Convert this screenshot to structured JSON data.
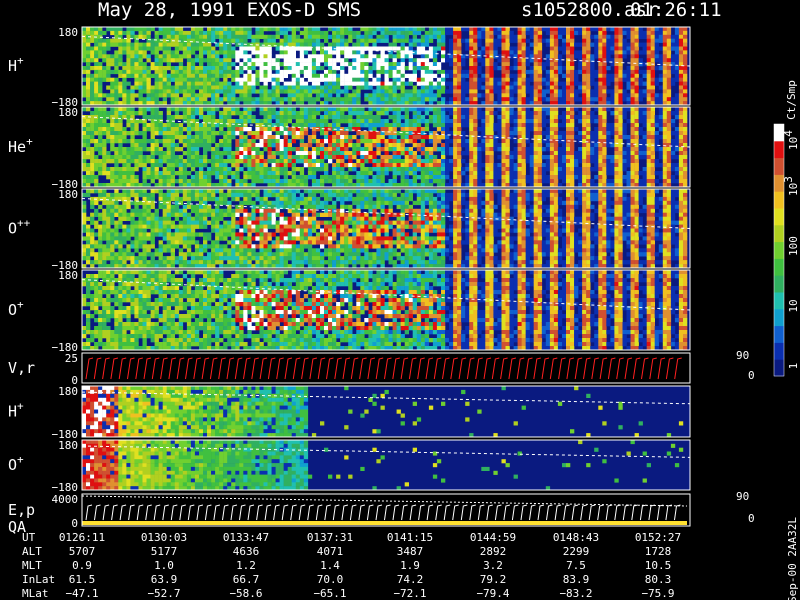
{
  "header": {
    "title": "May 28, 1991   EXOS-D SMS",
    "file": "s1052800.asr",
    "time": "01:26:11"
  },
  "colorbar": {
    "label": "Ct/Smp",
    "ticks": [
      "10",
      "10",
      "100",
      "10",
      "1"
    ],
    "exponents": [
      "4",
      "3",
      "",
      "",
      ""
    ],
    "levels": [
      10000,
      1000,
      100,
      10,
      1
    ]
  },
  "side_label": "Sep-00  2AA32L",
  "panels": [
    {
      "name": "H",
      "sup": "+",
      "ymax": "180",
      "ymin": "−180",
      "type": "spectrogram",
      "intensity": 0.9,
      "onset": 0.0
    },
    {
      "name": "He",
      "sup": "+",
      "ymax": "180",
      "ymin": "−180",
      "type": "spectrogram",
      "intensity": 0.55,
      "onset": 0.0
    },
    {
      "name": "O",
      "sup": "++",
      "ymax": "180",
      "ymin": "−180",
      "type": "spectrogram",
      "intensity": 0.55,
      "onset": 0.0
    },
    {
      "name": "O",
      "sup": "+",
      "ymax": "180",
      "ymin": "−180",
      "type": "spectrogram",
      "intensity": 0.6,
      "onset": 0.0
    },
    {
      "name": "V,r",
      "sup": "",
      "ymax": "25",
      "ymin": "0",
      "right_max": "90",
      "right_min": "0",
      "type": "line"
    },
    {
      "name": "H",
      "sup": "+",
      "ymax": "180",
      "ymin": "−180",
      "type": "spectrogram2",
      "intensity": 0.8,
      "onset": 0.0
    },
    {
      "name": "O",
      "sup": "+",
      "ymax": "180",
      "ymin": "−180",
      "type": "spectrogram2",
      "intensity": 0.55,
      "onset": 0.0
    },
    {
      "name": "E,p",
      "sup": "",
      "name2": "QA",
      "ymax": "4000",
      "ymin": "0",
      "right_max": "90",
      "right_min": "0",
      "type": "energy"
    }
  ],
  "footer": {
    "rows": [
      {
        "label": "UT",
        "values": [
          "0126:11",
          "0130:03",
          "0133:47",
          "0137:31",
          "0141:15",
          "0144:59",
          "0148:43",
          "0152:27"
        ]
      },
      {
        "label": "ALT",
        "values": [
          "5707",
          "5177",
          "4636",
          "4071",
          "3487",
          "2892",
          "2299",
          "1728"
        ]
      },
      {
        "label": "MLT",
        "values": [
          "0.9",
          "1.0",
          "1.2",
          "1.4",
          "1.9",
          "3.2",
          "7.5",
          "10.5"
        ]
      },
      {
        "label": "InLat",
        "values": [
          "61.5",
          "63.9",
          "66.7",
          "70.0",
          "74.2",
          "79.2",
          "83.9",
          "80.3"
        ]
      },
      {
        "label": "MLat",
        "values": [
          "−47.1",
          "−52.7",
          "−58.6",
          "−65.1",
          "−72.1",
          "−79.4",
          "−83.2",
          "−75.9"
        ]
      }
    ]
  },
  "colors": {
    "background": "#000000",
    "panel_bg": "#0a1a80",
    "trace": "#ff2020",
    "qa": "#ffe030"
  }
}
